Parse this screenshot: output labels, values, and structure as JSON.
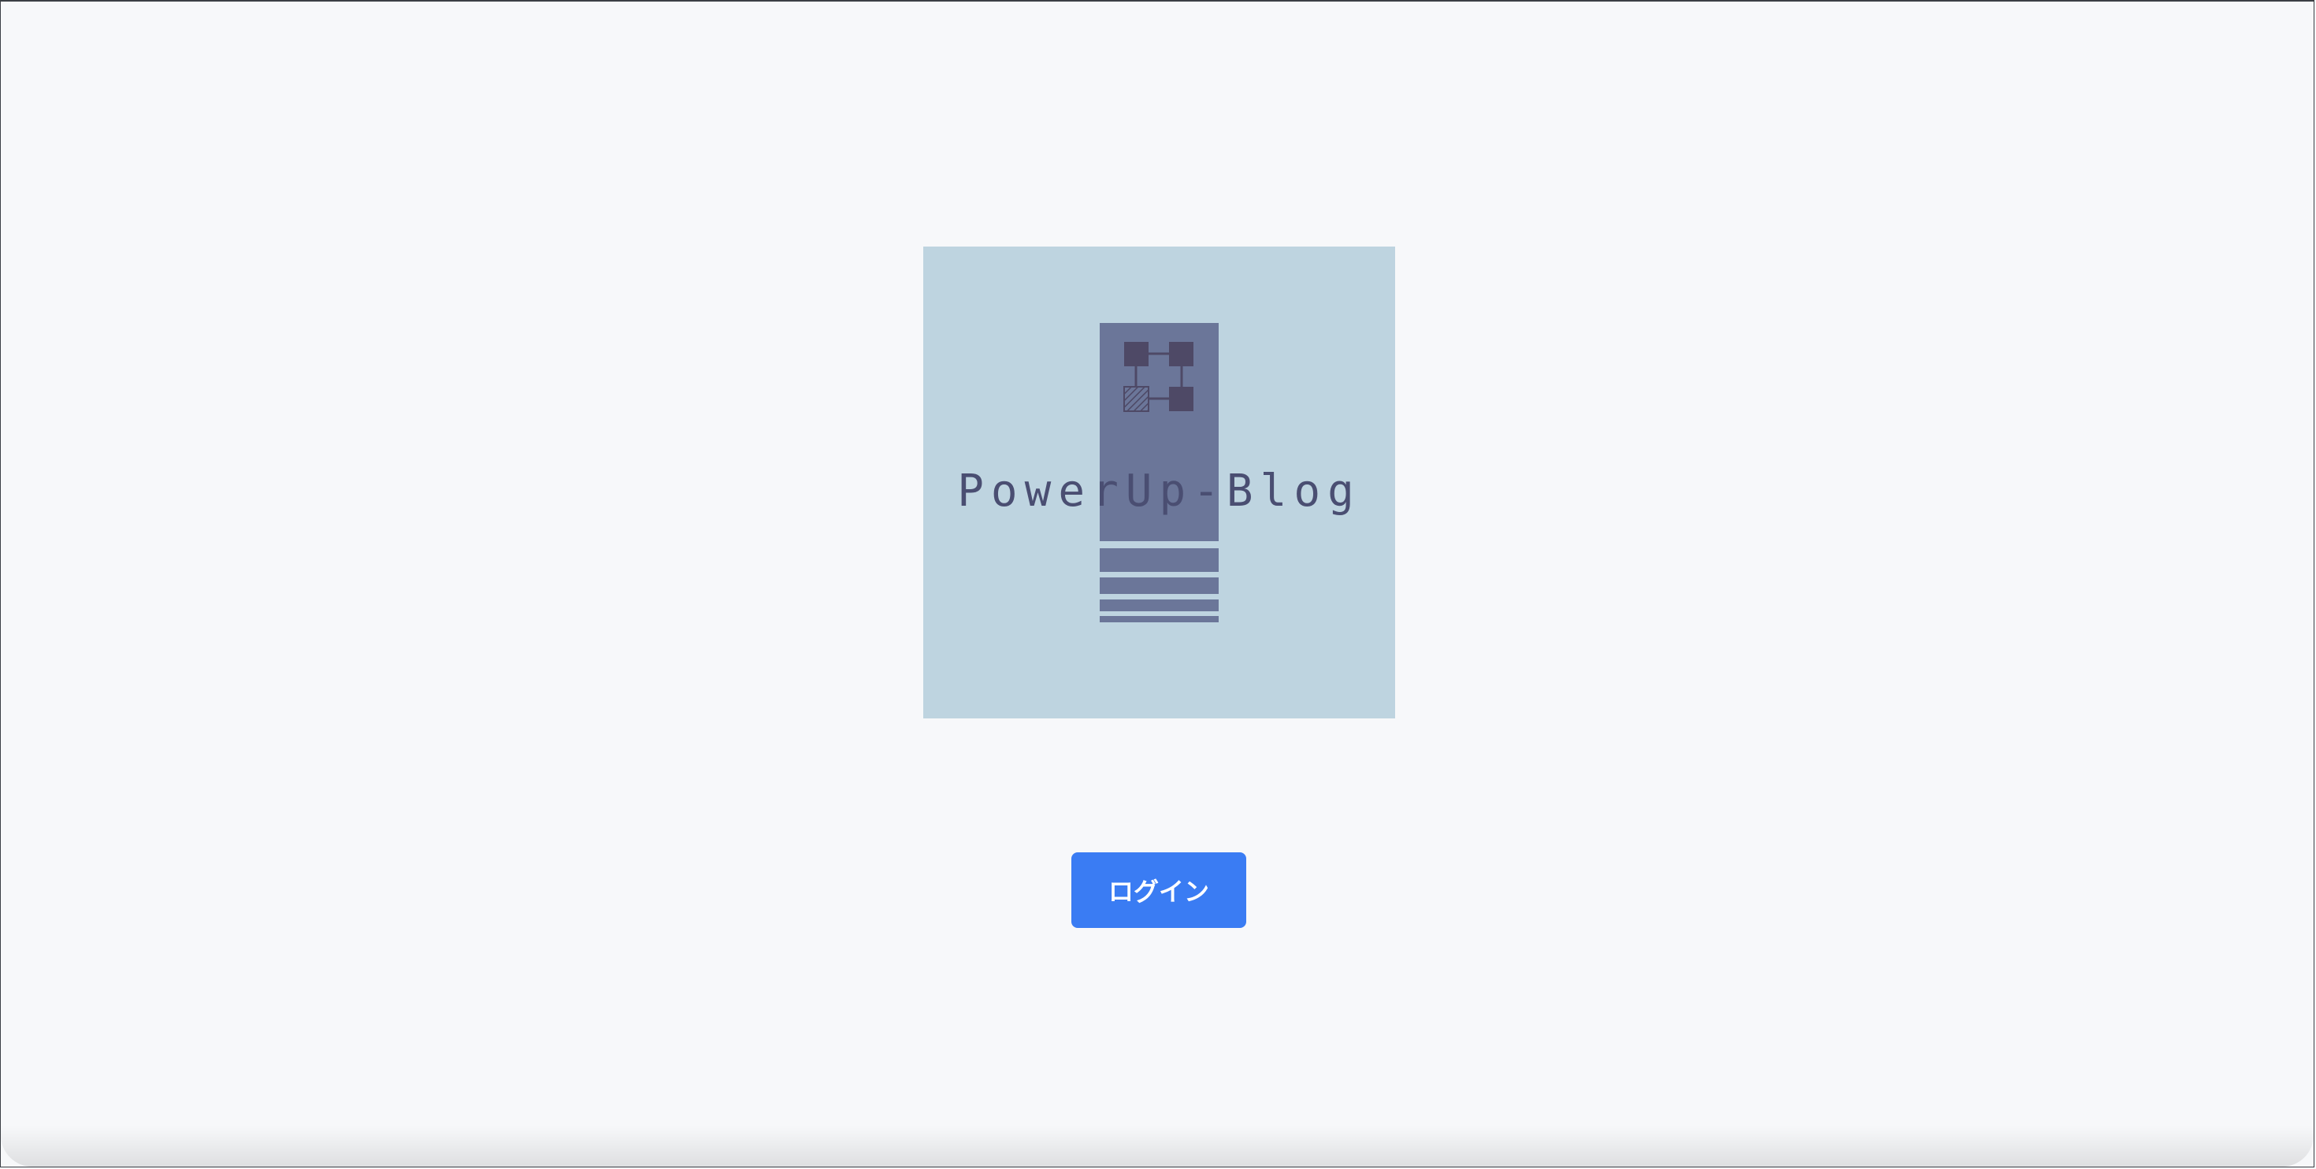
{
  "logo": {
    "text": "PowerUp-Blog",
    "icon": "circuit-book-icon",
    "background_color": "#bed4e0",
    "book_color": "#6b7699",
    "node_color": "#4e4966"
  },
  "actions": {
    "login_label": "ログイン",
    "button_color": "#3a7cf3"
  }
}
